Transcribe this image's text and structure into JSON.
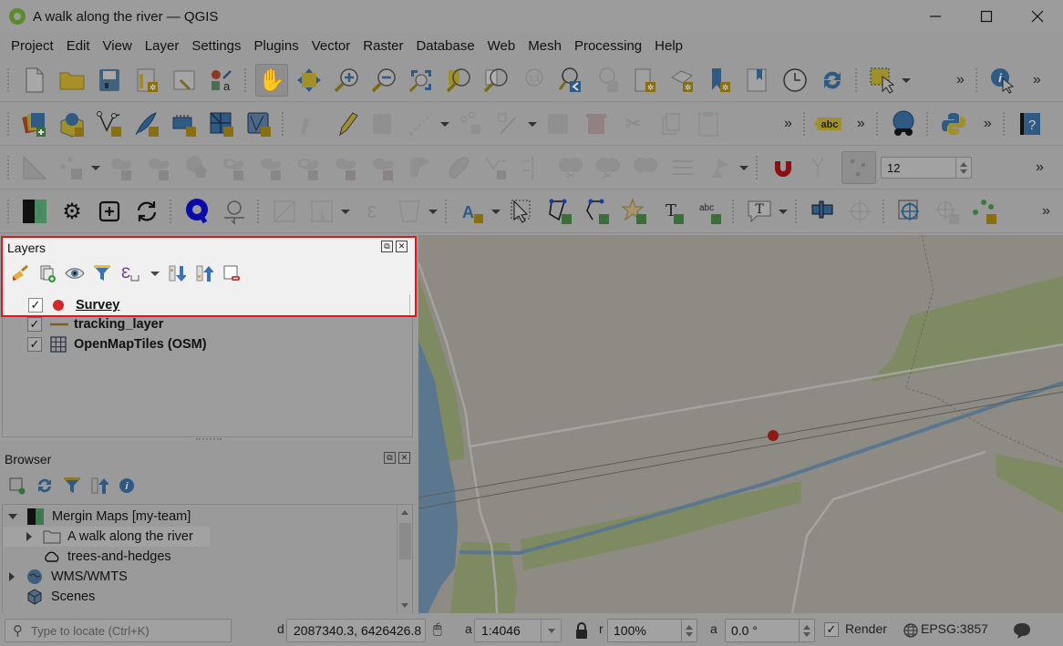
{
  "window": {
    "title": "A walk along the river — QGIS",
    "app_icon": "qgis-logo-icon",
    "controls": [
      "minimize",
      "maximize",
      "close"
    ]
  },
  "menubar": [
    "Project",
    "Edit",
    "View",
    "Layer",
    "Settings",
    "Plugins",
    "Vector",
    "Raster",
    "Database",
    "Web",
    "Mesh",
    "Processing",
    "Help"
  ],
  "toolbars": {
    "row1": [
      "new-project",
      "open-project",
      "save-project",
      "new-print-layout",
      "layout-manager",
      "style-manager",
      "pan-map",
      "pan-to-selection",
      "zoom-in",
      "zoom-out",
      "zoom-full",
      "zoom-to-selection",
      "zoom-to-layer",
      "zoom-native",
      "zoom-last",
      "zoom-next",
      "new-map-view",
      "new-3d-map-view",
      "new-bookmark",
      "show-bookmarks",
      "temporal-controller",
      "refresh",
      "select-features",
      "identify-features"
    ],
    "row2": [
      "data-source-manager",
      "new-geopackage-layer",
      "new-shapefile-layer",
      "new-temporary-scratch-layer",
      "new-virtual-layer",
      "new-mesh-layer",
      "new-vector-tile-layer",
      "current-edits",
      "toggle-editing",
      "save-layer-edits",
      "digitize-line",
      "vertex-tool",
      "modify-attributes",
      "delete-selected",
      "cut-features",
      "copy-features",
      "paste-features",
      "label-abc",
      "metasearch",
      "python-console",
      "help"
    ],
    "row3": [
      "measure",
      "move-feature",
      "rotate-feature",
      "simplify",
      "add-ring",
      "add-part",
      "fill-ring",
      "delete-ring",
      "delete-part",
      "reshape",
      "offset-curve",
      "reverse-line",
      "trim-extend",
      "split-features",
      "split-parts",
      "merge-features",
      "merge-attributes",
      "rotate-point-symbols",
      "enable-snapping",
      "snapping-mode",
      "snapping-tolerance"
    ],
    "snapping_tolerance": "12",
    "row4": [
      "mergin-maps",
      "mergin-settings",
      "mergin-create-project",
      "mergin-sync",
      "qfield-sync",
      "qfield-settings",
      "georef-1",
      "georef-2",
      "georef-3",
      "georef-4",
      "annotation-text-style",
      "select-annotation",
      "add-polygon-annotation",
      "add-line-annotation",
      "add-marker-annotation",
      "add-point-text-annotation",
      "add-line-text-annotation",
      "text-annotation",
      "pin-labels",
      "move-labels",
      "coordinate-capture",
      "gps-tracking",
      "processing-toolbox"
    ]
  },
  "layers_panel": {
    "title": "Layers",
    "tools": [
      "style-panel-icon",
      "add-group-icon",
      "manage-visibility-icon",
      "filter-legend-icon",
      "filter-expression-icon",
      "expand-all-icon",
      "collapse-all-icon",
      "remove-layer-icon"
    ],
    "layers": [
      {
        "name": "Survey",
        "checked": true,
        "symbol": "point",
        "symbol_color": "#d3262a",
        "active": true
      },
      {
        "name": "tracking_layer",
        "checked": true,
        "symbol": "line",
        "symbol_color": "#a0702a"
      },
      {
        "name": "OpenMapTiles (OSM)",
        "checked": true,
        "symbol": "grid",
        "symbol_color": "#2f3b4a"
      }
    ],
    "highlight_color": "#e8121b"
  },
  "browser_panel": {
    "title": "Browser",
    "tools": [
      "add-selected-layers-icon",
      "refresh-icon",
      "filter-icon",
      "collapse-all-icon",
      "info-icon"
    ],
    "items": [
      {
        "label": "Mergin Maps [my-team]",
        "expanded": true,
        "icon": "mergin-icon",
        "level": 0
      },
      {
        "label": "A walk along the river",
        "expanded": false,
        "icon": "folder-icon",
        "level": 1,
        "selected": true
      },
      {
        "label": "trees-and-hedges",
        "icon": "cloud-icon",
        "level": 1
      },
      {
        "label": "WMS/WMTS",
        "expanded": false,
        "icon": "globe-icon",
        "level": 0
      },
      {
        "label": "Scenes",
        "icon": "cube-icon",
        "level": 0
      }
    ]
  },
  "map": {
    "colors": {
      "background": "#8e8b84",
      "green": "#7d8a62",
      "water": "#5b7790",
      "road": "#a5a39e",
      "rail": "#5f5c56",
      "point": "#8c1a14"
    }
  },
  "statusbar": {
    "locator_placeholder": "Type to locate (Ctrl+K)",
    "coordinate_label": "d",
    "coordinate": "2087340.3, 6426426.8",
    "scale_label": "a",
    "scale": "1:4046",
    "magnifier_label": "r",
    "magnifier": "100%",
    "rotation_label": "a",
    "rotation": "0.0 °",
    "render_label": "Render",
    "render_checked": true,
    "crs": "EPSG:3857"
  }
}
